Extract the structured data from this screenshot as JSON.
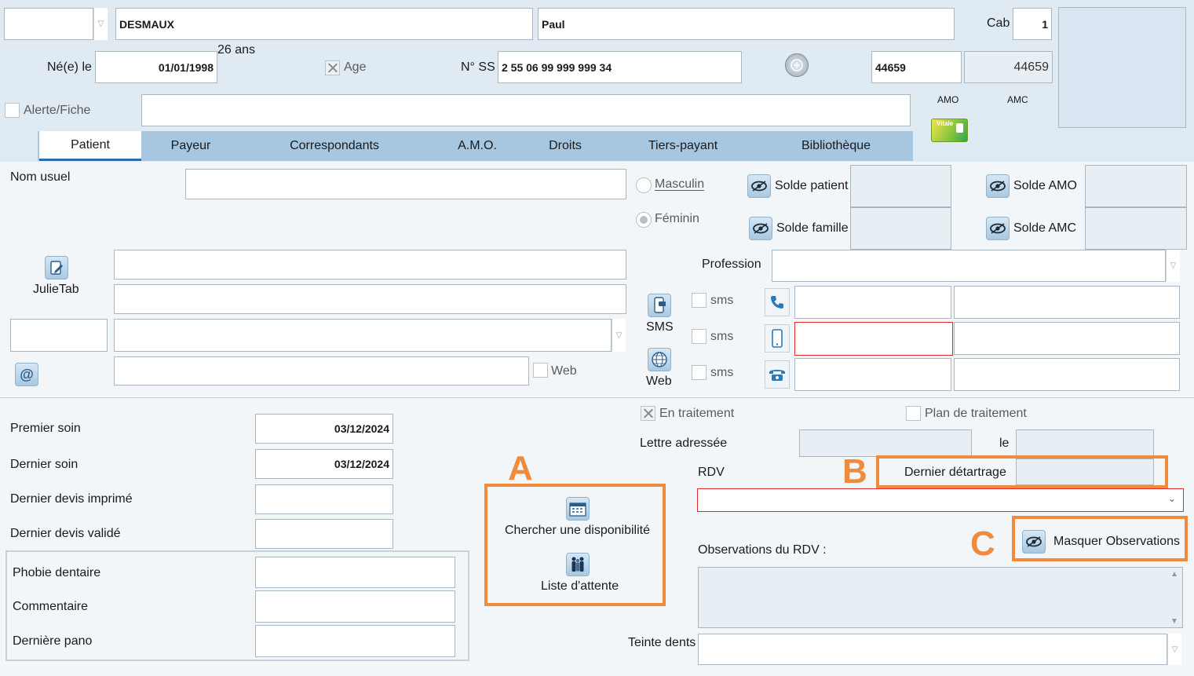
{
  "header": {
    "civility_value": "",
    "last_name": "DESMAUX",
    "first_name": "Paul",
    "cab_label": "Cab",
    "cab_value": "1",
    "age_text": "26 ans",
    "birth_label": "Né(e) le",
    "birth_date": "01/01/1998",
    "age_label": "Age",
    "ssn_label": "N° SS",
    "ssn_value": "2 55 06 99 999 999 34",
    "id_value": "44659",
    "id_display": "44659",
    "alert_label": "Alerte/Fiche",
    "alert_value": "",
    "amo_label": "AMO",
    "amc_label": "AMC",
    "vitale_text": "Vitale"
  },
  "tabs": [
    {
      "label": "Patient",
      "active": true
    },
    {
      "label": "Payeur"
    },
    {
      "label": "Correspondants"
    },
    {
      "label": "A.M.O."
    },
    {
      "label": "Droits"
    },
    {
      "label": "Tiers-payant"
    },
    {
      "label": "Bibliothèque"
    }
  ],
  "patient": {
    "nom_usuel_label": "Nom usuel",
    "masculin_label": "Masculin",
    "feminin_label": "Féminin",
    "gender_selected": "Féminin",
    "solde_patient_label": "Solde patient",
    "solde_famille_label": "Solde famille",
    "solde_amo_label": "Solde AMO",
    "solde_amc_label": "Solde AMC",
    "julietab_label": "JulieTab",
    "profession_label": "Profession",
    "sms_button_label": "SMS",
    "web_button_label": "Web",
    "sms_label": "sms",
    "web_label": "Web"
  },
  "treatment": {
    "premier_soin_label": "Premier soin",
    "premier_soin_value": "03/12/2024",
    "dernier_soin_label": "Dernier soin",
    "dernier_soin_value": "03/12/2024",
    "dernier_devis_imprime_label": "Dernier devis imprimé",
    "dernier_devis_valide_label": "Dernier devis validé",
    "phobie_label": "Phobie dentaire",
    "commentaire_label": "Commentaire",
    "derniere_pano_label": "Dernière pano",
    "en_traitement_label": "En traitement",
    "plan_traitement_label": "Plan de traitement",
    "lettre_adressee_label": "Lettre adressée",
    "le_label": "le",
    "rdv_label": "RDV",
    "dernier_detartrage_label": "Dernier détartrage",
    "observations_label": "Observations du RDV :",
    "teinte_label": "Teinte dents",
    "chercher_label": "Chercher une disponibilité",
    "liste_attente_label": "Liste d'attente",
    "masquer_label": "Masquer Observations"
  },
  "annotations": {
    "a": "A",
    "b": "B",
    "c": "C"
  },
  "colors": {
    "background": "#dfeaf3",
    "tab_bar": "#a7c6e0",
    "annotation": "#f08a3c",
    "required_border": "#e32b2b"
  }
}
